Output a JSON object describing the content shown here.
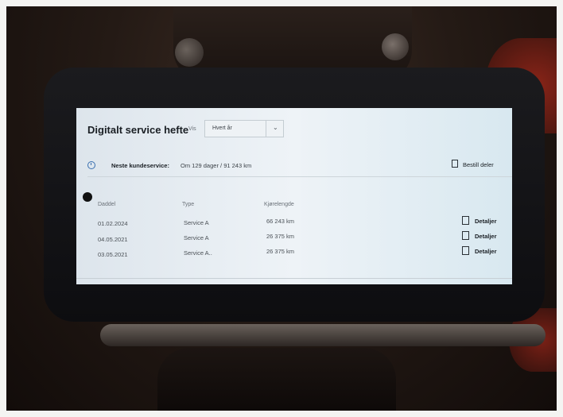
{
  "header": {
    "title": "Digitalt service hefte",
    "filter_label": "Vis",
    "filter_value": "Hvert år"
  },
  "next_service": {
    "label": "Neste kundeservice:",
    "value": "Om 129 dager / 91 243 km"
  },
  "order_parts_label": "Bestill deler",
  "table": {
    "columns": [
      "Daddel",
      "Type",
      "Kjørelengde"
    ],
    "rows": [
      {
        "date": "01.02.2024",
        "type": "Service A",
        "mileage": "66 243 km",
        "details": "Detaljer"
      },
      {
        "date": "04.05.2021",
        "type": "Service A",
        "mileage": "26 375 km",
        "details": "Detaljer"
      },
      {
        "date": "03.05.2021",
        "type": "Service A..",
        "mileage": "26 375 km",
        "details": "Detaljer"
      }
    ]
  }
}
